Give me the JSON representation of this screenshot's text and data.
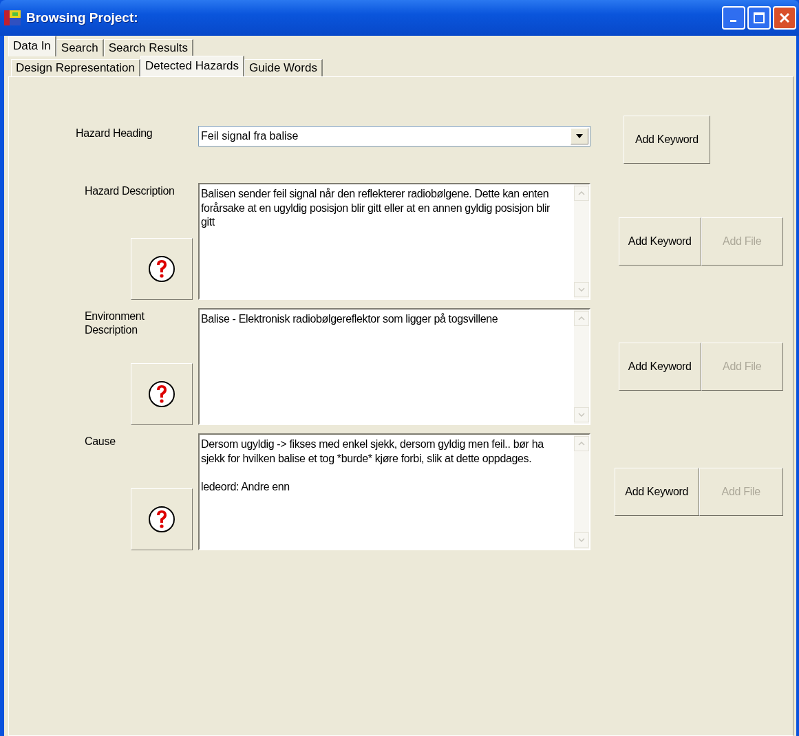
{
  "window": {
    "title": "Browsing Project:"
  },
  "tabs": [
    {
      "label": "Data In",
      "selected": true
    },
    {
      "label": "Search",
      "selected": false
    },
    {
      "label": "Search Results",
      "selected": false
    }
  ],
  "subtabs": [
    {
      "label": "Design Representation",
      "selected": false
    },
    {
      "label": "Detected Hazards",
      "selected": true
    },
    {
      "label": "Guide Words",
      "selected": false
    }
  ],
  "fields": [
    {
      "kind": "combo",
      "label": "Hazard Heading",
      "value": "Feil signal fra balise",
      "buttons": [
        {
          "label": "Add Keyword",
          "disabled": false
        }
      ]
    },
    {
      "kind": "text",
      "label": "Hazard Description",
      "value": "Balisen sender feil signal når den reflekterer radiobølgene. Dette kan enten forårsake at en ugyldig posisjon blir gitt eller at en annen gyldig posisjon blir gitt",
      "buttons": [
        {
          "label": "Add Keyword",
          "disabled": false
        },
        {
          "label": "Add File",
          "disabled": true
        }
      ]
    },
    {
      "kind": "text",
      "label": "Environment Description",
      "value": "Balise - Elektronisk radiobølgereflektor som ligger på togsvillene",
      "buttons": [
        {
          "label": "Add Keyword",
          "disabled": false
        },
        {
          "label": "Add File",
          "disabled": true
        }
      ]
    },
    {
      "kind": "text",
      "label": "Cause",
      "value": "Dersom ugyldig -> fikses med enkel sjekk, dersom gyldig men feil.. bør ha sjekk for hvilken balise et tog *burde* kjøre forbi, slik at dette oppdages.\n\nledeord: Andre enn",
      "buttons": [
        {
          "label": "Add Keyword",
          "disabled": false
        },
        {
          "label": "Add File",
          "disabled": true
        }
      ]
    }
  ]
}
